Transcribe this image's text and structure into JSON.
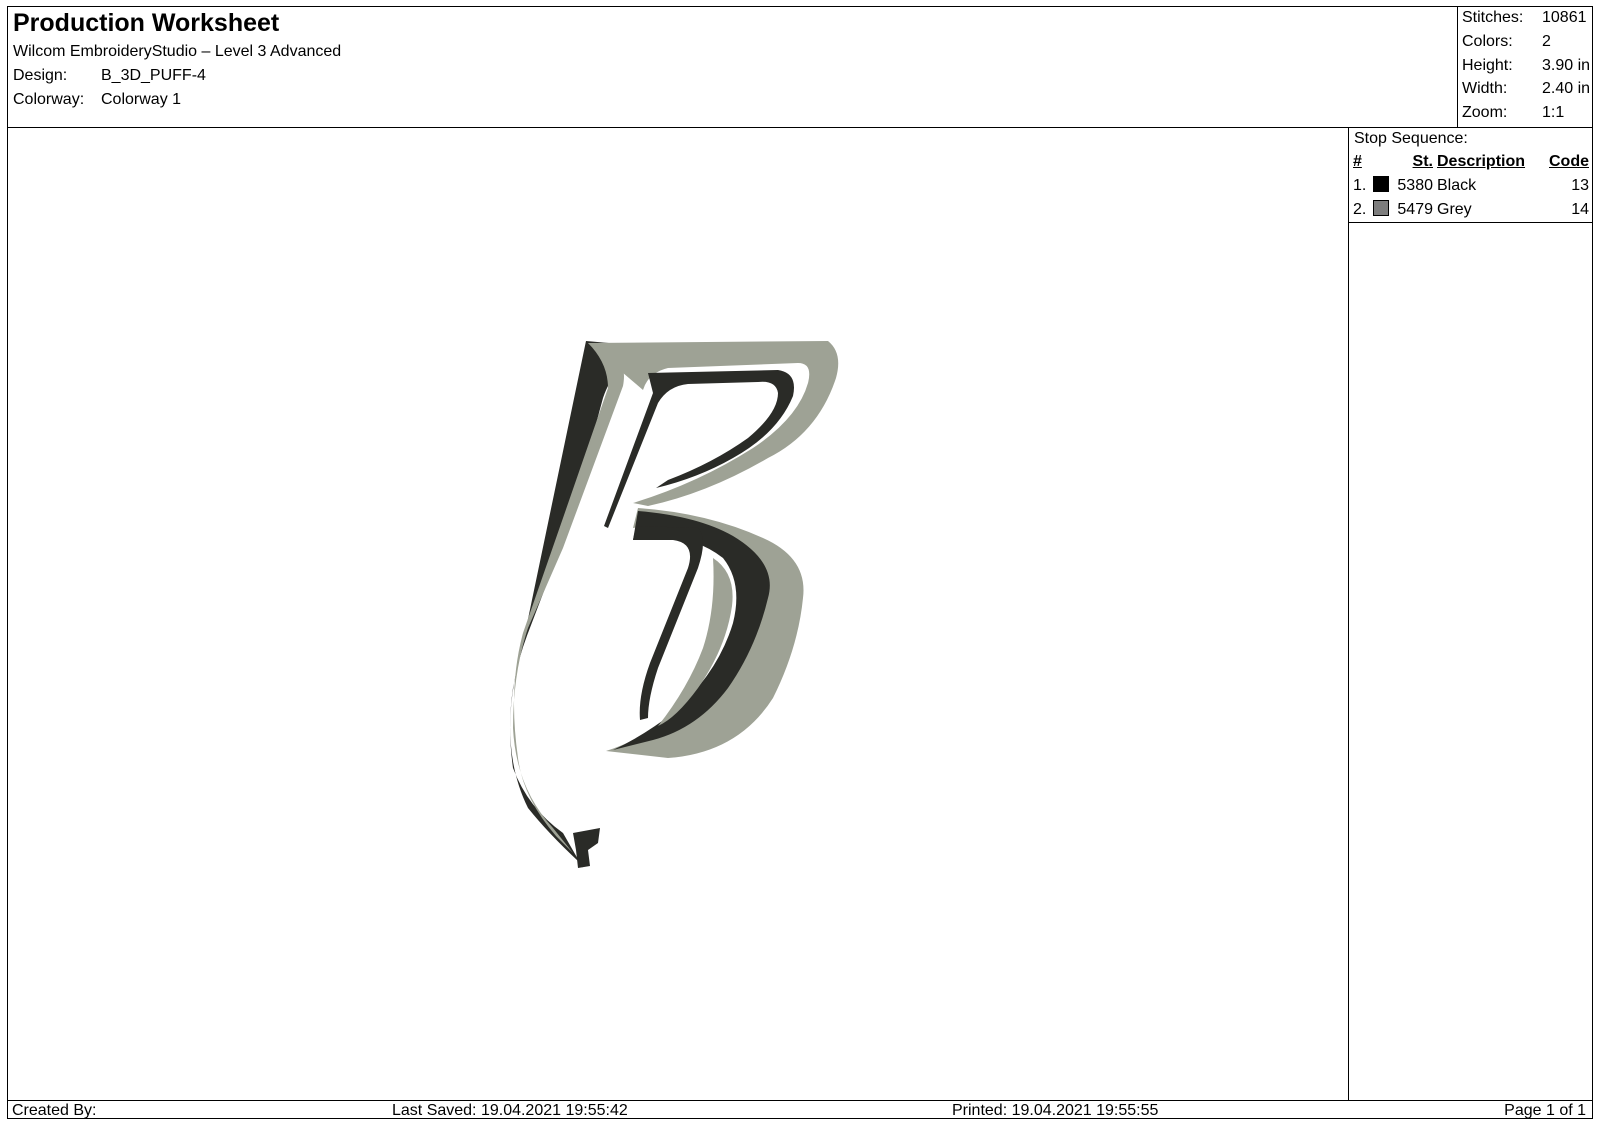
{
  "header": {
    "title": "Production Worksheet",
    "software": "Wilcom EmbroideryStudio – Level 3 Advanced",
    "design_label": "Design:",
    "design_value": "B_3D_PUFF-4",
    "colorway_label": "Colorway:",
    "colorway_value": "Colorway 1"
  },
  "stats": [
    {
      "label": "Stitches:",
      "value": "10861"
    },
    {
      "label": "Colors:",
      "value": "2"
    },
    {
      "label": "Height:",
      "value": "3.90 in"
    },
    {
      "label": "Width:",
      "value": "2.40 in"
    },
    {
      "label": "Zoom:",
      "value": "1:1"
    }
  ],
  "stop_sequence": {
    "title": "Stop Sequence:",
    "headers": {
      "num": "#",
      "st": "St.",
      "desc": "Description",
      "code": "Code"
    },
    "rows": [
      {
        "num": "1.",
        "swatch": "#000000",
        "st": "5380",
        "desc": "Black",
        "code": "13"
      },
      {
        "num": "2.",
        "swatch": "#7d7d7d",
        "st": "5479",
        "desc": "Grey",
        "code": "14"
      }
    ]
  },
  "design_colors": {
    "fill": "#9ea295",
    "dark": "#2a2b27",
    "shade": "#5c5f55"
  },
  "footer": {
    "created": "Created By:",
    "saved": "Last Saved: 19.04.2021 19:55:42",
    "printed": "Printed: 19.04.2021 19:55:55",
    "page": "Page 1 of 1"
  }
}
